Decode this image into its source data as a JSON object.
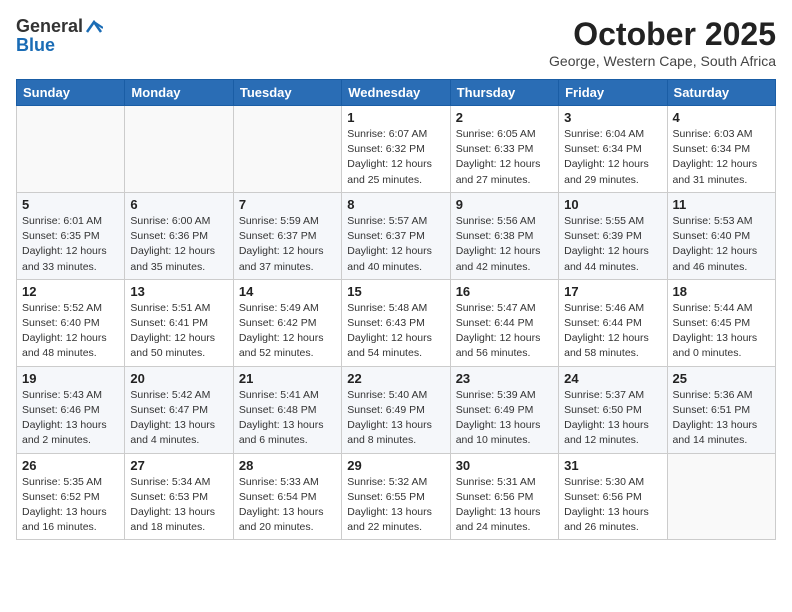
{
  "logo": {
    "general": "General",
    "blue": "Blue"
  },
  "header": {
    "month": "October 2025",
    "location": "George, Western Cape, South Africa"
  },
  "weekdays": [
    "Sunday",
    "Monday",
    "Tuesday",
    "Wednesday",
    "Thursday",
    "Friday",
    "Saturday"
  ],
  "weeks": [
    [
      {
        "day": "",
        "info": ""
      },
      {
        "day": "",
        "info": ""
      },
      {
        "day": "",
        "info": ""
      },
      {
        "day": "1",
        "info": "Sunrise: 6:07 AM\nSunset: 6:32 PM\nDaylight: 12 hours\nand 25 minutes."
      },
      {
        "day": "2",
        "info": "Sunrise: 6:05 AM\nSunset: 6:33 PM\nDaylight: 12 hours\nand 27 minutes."
      },
      {
        "day": "3",
        "info": "Sunrise: 6:04 AM\nSunset: 6:34 PM\nDaylight: 12 hours\nand 29 minutes."
      },
      {
        "day": "4",
        "info": "Sunrise: 6:03 AM\nSunset: 6:34 PM\nDaylight: 12 hours\nand 31 minutes."
      }
    ],
    [
      {
        "day": "5",
        "info": "Sunrise: 6:01 AM\nSunset: 6:35 PM\nDaylight: 12 hours\nand 33 minutes."
      },
      {
        "day": "6",
        "info": "Sunrise: 6:00 AM\nSunset: 6:36 PM\nDaylight: 12 hours\nand 35 minutes."
      },
      {
        "day": "7",
        "info": "Sunrise: 5:59 AM\nSunset: 6:37 PM\nDaylight: 12 hours\nand 37 minutes."
      },
      {
        "day": "8",
        "info": "Sunrise: 5:57 AM\nSunset: 6:37 PM\nDaylight: 12 hours\nand 40 minutes."
      },
      {
        "day": "9",
        "info": "Sunrise: 5:56 AM\nSunset: 6:38 PM\nDaylight: 12 hours\nand 42 minutes."
      },
      {
        "day": "10",
        "info": "Sunrise: 5:55 AM\nSunset: 6:39 PM\nDaylight: 12 hours\nand 44 minutes."
      },
      {
        "day": "11",
        "info": "Sunrise: 5:53 AM\nSunset: 6:40 PM\nDaylight: 12 hours\nand 46 minutes."
      }
    ],
    [
      {
        "day": "12",
        "info": "Sunrise: 5:52 AM\nSunset: 6:40 PM\nDaylight: 12 hours\nand 48 minutes."
      },
      {
        "day": "13",
        "info": "Sunrise: 5:51 AM\nSunset: 6:41 PM\nDaylight: 12 hours\nand 50 minutes."
      },
      {
        "day": "14",
        "info": "Sunrise: 5:49 AM\nSunset: 6:42 PM\nDaylight: 12 hours\nand 52 minutes."
      },
      {
        "day": "15",
        "info": "Sunrise: 5:48 AM\nSunset: 6:43 PM\nDaylight: 12 hours\nand 54 minutes."
      },
      {
        "day": "16",
        "info": "Sunrise: 5:47 AM\nSunset: 6:44 PM\nDaylight: 12 hours\nand 56 minutes."
      },
      {
        "day": "17",
        "info": "Sunrise: 5:46 AM\nSunset: 6:44 PM\nDaylight: 12 hours\nand 58 minutes."
      },
      {
        "day": "18",
        "info": "Sunrise: 5:44 AM\nSunset: 6:45 PM\nDaylight: 13 hours\nand 0 minutes."
      }
    ],
    [
      {
        "day": "19",
        "info": "Sunrise: 5:43 AM\nSunset: 6:46 PM\nDaylight: 13 hours\nand 2 minutes."
      },
      {
        "day": "20",
        "info": "Sunrise: 5:42 AM\nSunset: 6:47 PM\nDaylight: 13 hours\nand 4 minutes."
      },
      {
        "day": "21",
        "info": "Sunrise: 5:41 AM\nSunset: 6:48 PM\nDaylight: 13 hours\nand 6 minutes."
      },
      {
        "day": "22",
        "info": "Sunrise: 5:40 AM\nSunset: 6:49 PM\nDaylight: 13 hours\nand 8 minutes."
      },
      {
        "day": "23",
        "info": "Sunrise: 5:39 AM\nSunset: 6:49 PM\nDaylight: 13 hours\nand 10 minutes."
      },
      {
        "day": "24",
        "info": "Sunrise: 5:37 AM\nSunset: 6:50 PM\nDaylight: 13 hours\nand 12 minutes."
      },
      {
        "day": "25",
        "info": "Sunrise: 5:36 AM\nSunset: 6:51 PM\nDaylight: 13 hours\nand 14 minutes."
      }
    ],
    [
      {
        "day": "26",
        "info": "Sunrise: 5:35 AM\nSunset: 6:52 PM\nDaylight: 13 hours\nand 16 minutes."
      },
      {
        "day": "27",
        "info": "Sunrise: 5:34 AM\nSunset: 6:53 PM\nDaylight: 13 hours\nand 18 minutes."
      },
      {
        "day": "28",
        "info": "Sunrise: 5:33 AM\nSunset: 6:54 PM\nDaylight: 13 hours\nand 20 minutes."
      },
      {
        "day": "29",
        "info": "Sunrise: 5:32 AM\nSunset: 6:55 PM\nDaylight: 13 hours\nand 22 minutes."
      },
      {
        "day": "30",
        "info": "Sunrise: 5:31 AM\nSunset: 6:56 PM\nDaylight: 13 hours\nand 24 minutes."
      },
      {
        "day": "31",
        "info": "Sunrise: 5:30 AM\nSunset: 6:56 PM\nDaylight: 13 hours\nand 26 minutes."
      },
      {
        "day": "",
        "info": ""
      }
    ]
  ]
}
